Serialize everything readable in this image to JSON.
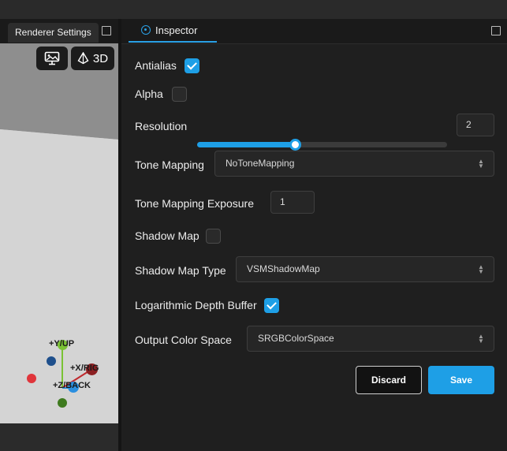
{
  "viewport": {
    "tab_label": "Renderer Settings",
    "mode_label": "3D",
    "axes": {
      "y": "+Y/UP",
      "x": "+X/RIG",
      "z": "+Z/BACK"
    },
    "axis_colors": {
      "y": "#7ac234",
      "x": "#c0282d",
      "z": "#2a8fe0",
      "neg_x": "#e0353b",
      "neg_y": "#3e7a1e",
      "neg_z": "#1e4f8c"
    }
  },
  "inspector": {
    "tab_label": "Inspector",
    "fields": {
      "antialias": {
        "label": "Antialias",
        "checked": true
      },
      "alpha": {
        "label": "Alpha",
        "checked": false
      },
      "resolution": {
        "label": "Resolution",
        "value": "2",
        "slider_fraction": 0.39
      },
      "tone_mapping": {
        "label": "Tone Mapping",
        "value": "NoToneMapping"
      },
      "tone_mapping_exposure": {
        "label": "Tone Mapping Exposure",
        "value": "1"
      },
      "shadow_map": {
        "label": "Shadow Map",
        "checked": false
      },
      "shadow_map_type": {
        "label": "Shadow Map Type",
        "value": "VSMShadowMap"
      },
      "log_depth": {
        "label": "Logarithmic Depth Buffer",
        "checked": true
      },
      "output_color_space": {
        "label": "Output Color Space",
        "value": "SRGBColorSpace"
      }
    },
    "actions": {
      "discard": "Discard",
      "save": "Save"
    }
  },
  "colors": {
    "accent": "#1e9fe6",
    "panel": "#1f1f1f"
  }
}
